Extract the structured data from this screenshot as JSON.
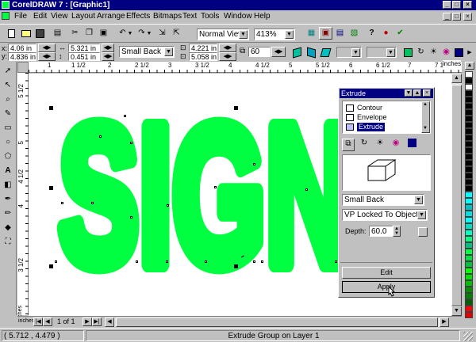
{
  "app": {
    "title": "CorelDRAW 7 : [Graphic1]",
    "doc_controls": [
      "_",
      "□",
      "×"
    ]
  },
  "menu": [
    "File",
    "Edit",
    "View",
    "Layout",
    "Arrange",
    "Effects",
    "Bitmaps",
    "Text",
    "Tools",
    "Window",
    "Help"
  ],
  "toolbar": {
    "view_mode": "Normal View",
    "zoom": "413%"
  },
  "property_bar": {
    "x": "4.06 in",
    "y": "4.836 in",
    "width": "5.321 in",
    "height": "0.451 in",
    "extrude_type": "Small Back",
    "scale_x": "4.221 in",
    "scale_y": "5.058 in",
    "depth": "60"
  },
  "ruler": {
    "units": "inches",
    "h_numbers": [
      "1",
      "1 1/2",
      "2",
      "2 1/2",
      "3",
      "3 1/2",
      "4",
      "4 1/2",
      "5",
      "5 1/2",
      "6",
      "6 1/2",
      "7",
      "7 1/2"
    ],
    "v_numbers": [
      "5 1/2",
      "5",
      "4 1/2",
      "4",
      "3 1/2"
    ]
  },
  "canvas": {
    "artwork_text": "SIGN",
    "artwork_color": "#00ff40"
  },
  "docker": {
    "title": "Extrude",
    "list": [
      "Contour",
      "Envelope",
      "Extrude"
    ],
    "selected": "Extrude",
    "extrude_type": "Small Back",
    "vanishing_point": "VP Locked To Object",
    "depth_label": "Depth:",
    "depth_value": "60.0",
    "edit_label": "Edit",
    "apply_label": "Apply"
  },
  "pages": {
    "indicator": "1 of 1"
  },
  "status": {
    "coords": "( 5.712 , 4.479 )",
    "message": "Extrude Group on Layer 1"
  },
  "palette": [
    "#ffffff",
    "#000000",
    "#ffffff",
    "#000000",
    "#000000",
    "#000000",
    "#000000",
    "#000000",
    "#000000",
    "#000000",
    "#000000",
    "#000000",
    "#000000",
    "#000000",
    "#000000",
    "#000000",
    "#000000",
    "#000000",
    "#000000",
    "#00ffff",
    "#00ffff",
    "#00c0c0",
    "#00e0e0",
    "#00ffff",
    "#00e0c0",
    "#00ffc0",
    "#00ff80",
    "#00c080",
    "#00ff40",
    "#00e040",
    "#00c040",
    "#00ff00",
    "#00e000",
    "#00c000",
    "#009000",
    "#008000",
    "#006000",
    "#ff0000",
    "#e00000"
  ],
  "colors": {
    "titlebar": "#000080",
    "artwork": "#00ff40",
    "docker_title": "#000080"
  }
}
